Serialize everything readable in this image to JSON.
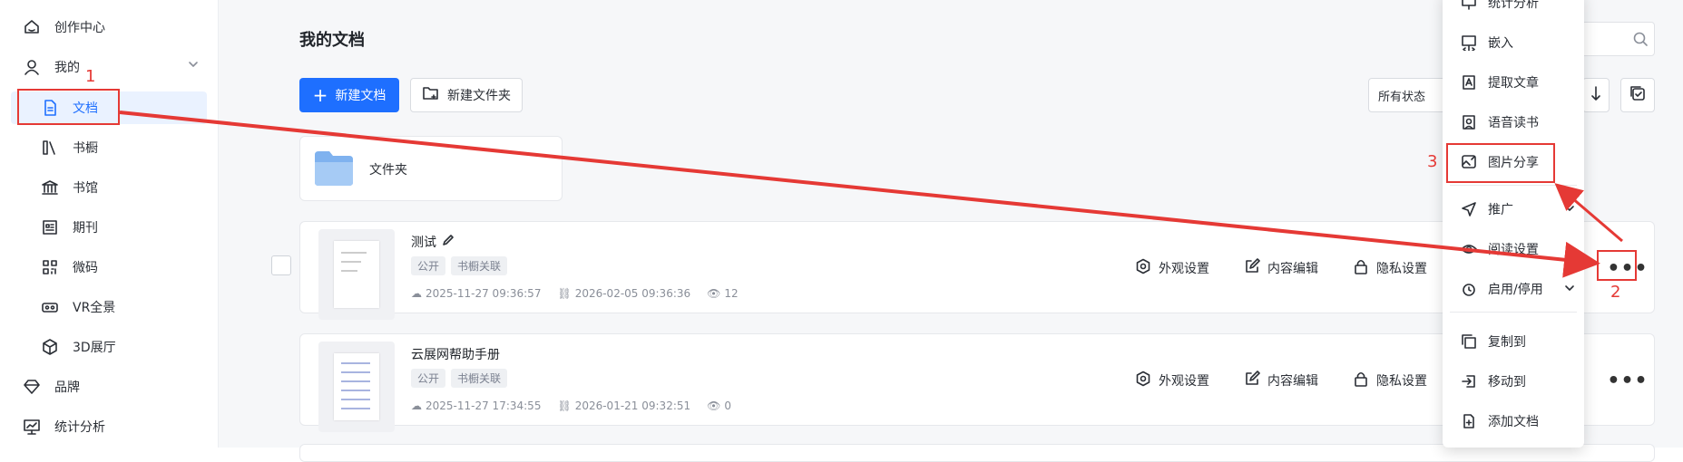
{
  "sidebar": {
    "items": [
      {
        "label": "创作中心"
      },
      {
        "label": "我的"
      },
      {
        "label": "文档"
      },
      {
        "label": "书橱"
      },
      {
        "label": "书馆"
      },
      {
        "label": "期刊"
      },
      {
        "label": "微码"
      },
      {
        "label": "VR全景"
      },
      {
        "label": "3D展厅"
      },
      {
        "label": "品牌"
      },
      {
        "label": "统计分析"
      }
    ]
  },
  "main": {
    "title": "我的文档",
    "new_doc_label": "新建文档",
    "new_folder_label": "新建文件夹",
    "status_filter": "所有状态",
    "folder": {
      "name": "文件夹"
    },
    "documents": [
      {
        "title": "测试",
        "tags": [
          "公开",
          "书橱关联"
        ],
        "created": "2025-11-27 09:36:57",
        "updated": "2026-02-05 09:36:36",
        "views": "12"
      },
      {
        "title": "云展网帮助手册",
        "tags": [
          "公开",
          "书橱关联"
        ],
        "created": "2025-11-27 17:34:55",
        "updated": "2026-01-21 09:32:51",
        "views": "0"
      }
    ],
    "actions": {
      "appearance": "外观设置",
      "content_edit": "内容编辑",
      "privacy": "隐私设置"
    }
  },
  "menu": {
    "items": [
      {
        "label": "统计分析"
      },
      {
        "label": "嵌入"
      },
      {
        "label": "提取文章"
      },
      {
        "label": "语音读书"
      },
      {
        "label": "图片分享"
      },
      {
        "label": "推广"
      },
      {
        "label": "阅读设置"
      },
      {
        "label": "启用/停用"
      },
      {
        "label": "复制到"
      },
      {
        "label": "移动到"
      },
      {
        "label": "添加文档"
      }
    ]
  },
  "annotations": {
    "step1": "1",
    "step2": "2",
    "step3": "3",
    "color": "#e53935"
  }
}
